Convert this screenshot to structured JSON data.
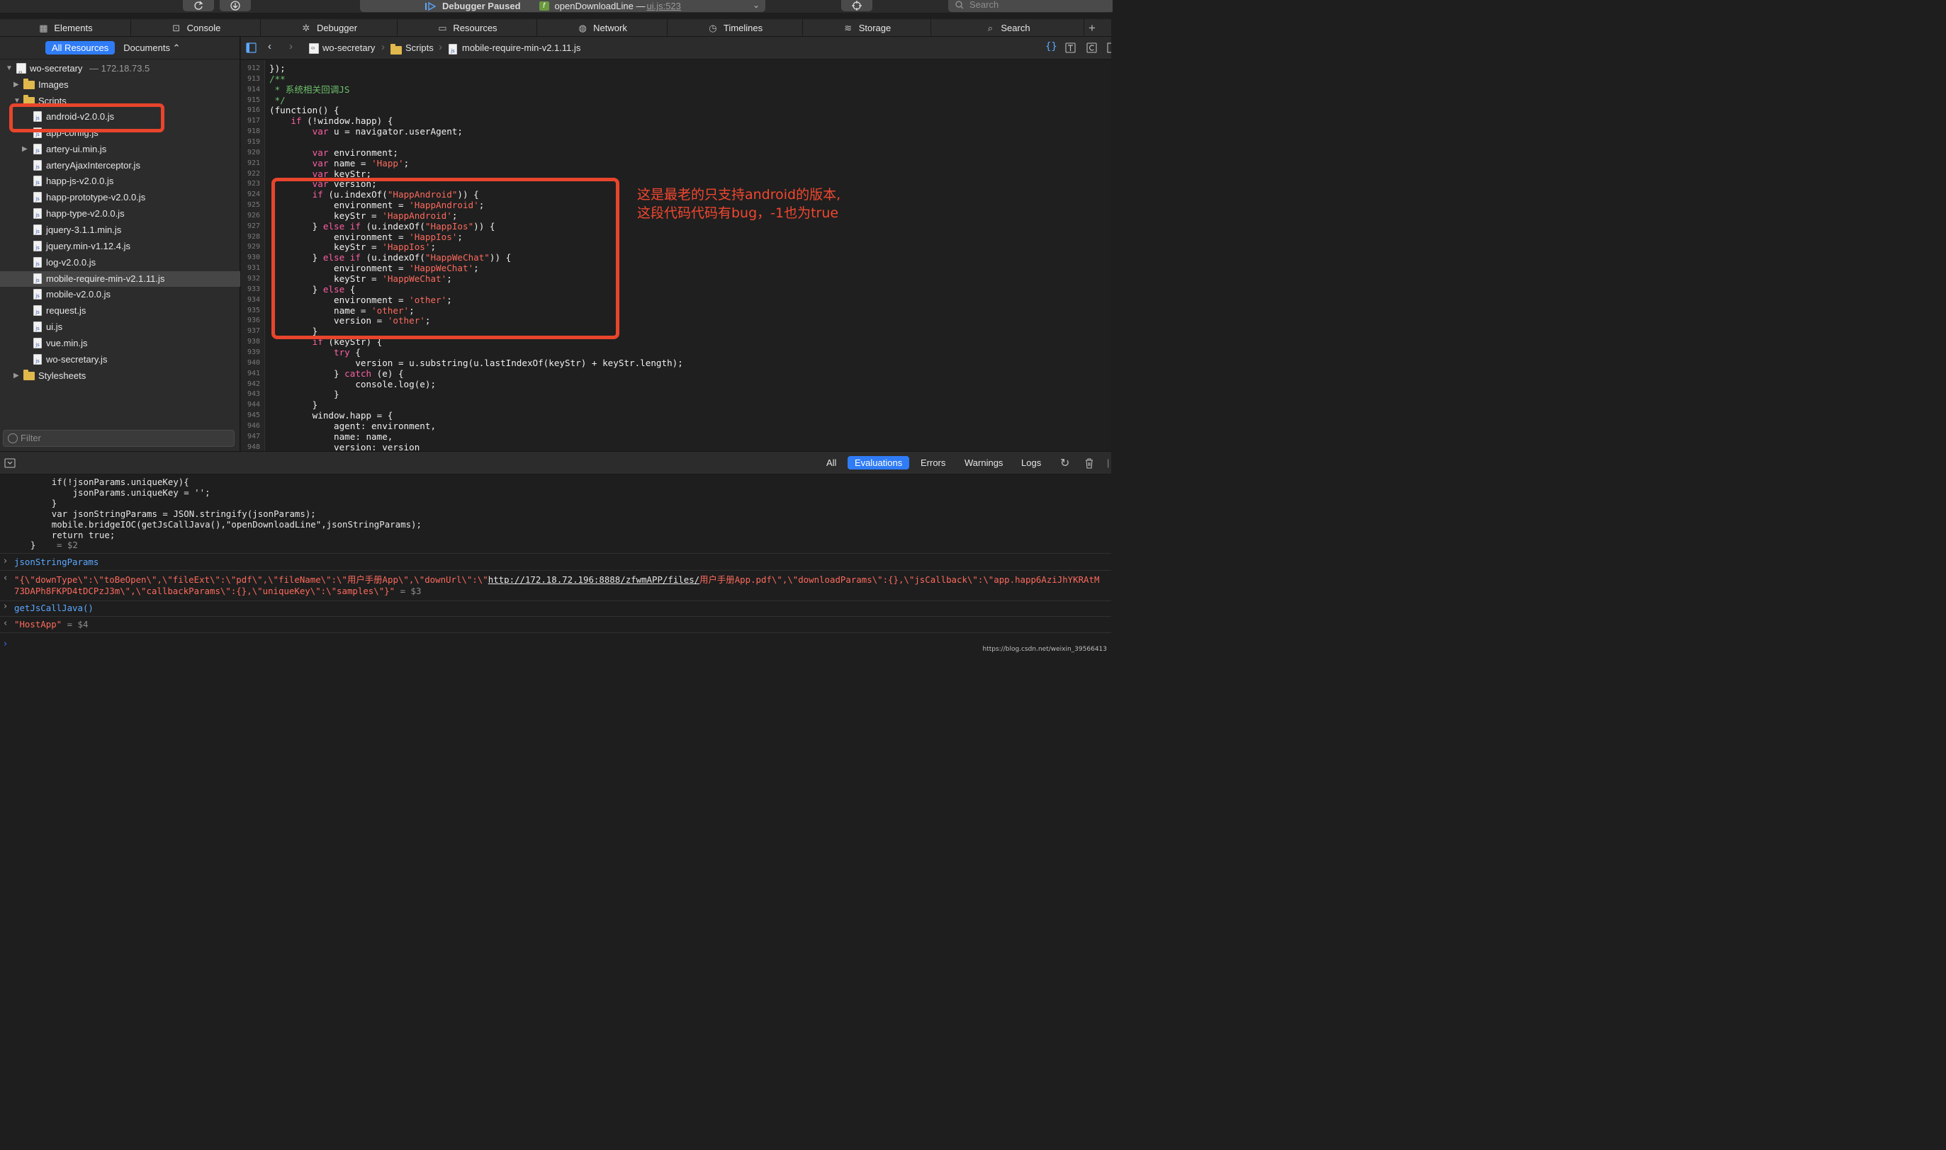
{
  "toolbar": {
    "debugger_status": "Debugger Paused",
    "function_name": "openDownloadLine —",
    "function_location": "ui.js:523",
    "search_placeholder": "Search"
  },
  "tabs": [
    {
      "label": "Elements",
      "icon": "elements-icon"
    },
    {
      "label": "Console",
      "icon": "console-icon"
    },
    {
      "label": "Debugger",
      "icon": "debugger-icon"
    },
    {
      "label": "Resources",
      "icon": "resources-icon"
    },
    {
      "label": "Network",
      "icon": "network-icon"
    },
    {
      "label": "Timelines",
      "icon": "timelines-icon"
    },
    {
      "label": "Storage",
      "icon": "storage-icon"
    },
    {
      "label": "Search",
      "icon": "search-icon"
    }
  ],
  "sidebar": {
    "all_resources": "All Resources",
    "documents": "Documents ⌃",
    "site_name": "wo-secretary",
    "site_address": "— 172.18.73.5",
    "folders": {
      "images": "Images",
      "scripts": "Scripts",
      "stylesheets": "Stylesheets"
    },
    "files": [
      "android-v2.0.0.js",
      "app-config.js",
      "artery-ui.min.js",
      "arteryAjaxInterceptor.js",
      "happ-js-v2.0.0.js",
      "happ-prototype-v2.0.0.js",
      "happ-type-v2.0.0.js",
      "jquery-3.1.1.min.js",
      "jquery.min-v1.12.4.js",
      "log-v2.0.0.js",
      "mobile-require-min-v2.1.11.js",
      "mobile-v2.0.0.js",
      "request.js",
      "ui.js",
      "vue.min.js",
      "wo-secretary.js"
    ],
    "selected_file": "mobile-require-min-v2.1.11.js",
    "filter_placeholder": "Filter"
  },
  "breadcrumb": {
    "site": "wo-secretary",
    "folder": "Scripts",
    "file": "mobile-require-min-v2.1.11.js"
  },
  "editor": {
    "line_numbers": [
      "912",
      "913",
      "914",
      "915",
      "916",
      "917",
      "918",
      "919",
      "920",
      "921",
      "922",
      "923",
      "924",
      "925",
      "926",
      "927",
      "928",
      "929",
      "930",
      "931",
      "932",
      "933",
      "934",
      "935",
      "936",
      "937",
      "938",
      "939",
      "940",
      "941",
      "942",
      "943",
      "944",
      "945",
      "946",
      "947",
      "948"
    ],
    "lines": [
      [
        [
          "p",
          "});"
        ]
      ],
      [
        [
          "c",
          "/**"
        ]
      ],
      [
        [
          "c",
          " * 系统相关回调JS"
        ]
      ],
      [
        [
          "c",
          " */"
        ]
      ],
      [
        [
          "p",
          "(function() {"
        ]
      ],
      [
        [
          "p",
          "    "
        ],
        [
          "k",
          "if"
        ],
        [
          "p",
          " (!window.happ) {"
        ]
      ],
      [
        [
          "p",
          "        "
        ],
        [
          "k",
          "var"
        ],
        [
          "p",
          " u = navigator.userAgent;"
        ]
      ],
      [
        [
          "p",
          ""
        ]
      ],
      [
        [
          "p",
          "        "
        ],
        [
          "k",
          "var"
        ],
        [
          "p",
          " environment;"
        ]
      ],
      [
        [
          "p",
          "        "
        ],
        [
          "k",
          "var"
        ],
        [
          "p",
          " name = "
        ],
        [
          "s",
          "'Happ'"
        ],
        [
          "p",
          ";"
        ]
      ],
      [
        [
          "p",
          "        "
        ],
        [
          "k",
          "var"
        ],
        [
          "p",
          " keyStr;"
        ]
      ],
      [
        [
          "p",
          "        "
        ],
        [
          "k",
          "var"
        ],
        [
          "p",
          " version;"
        ]
      ],
      [
        [
          "p",
          "        "
        ],
        [
          "k",
          "if"
        ],
        [
          "p",
          " (u.indexOf("
        ],
        [
          "s",
          "\"HappAndroid\""
        ],
        [
          "p",
          ")) {"
        ]
      ],
      [
        [
          "p",
          "            environment = "
        ],
        [
          "s",
          "'HappAndroid'"
        ],
        [
          "p",
          ";"
        ]
      ],
      [
        [
          "p",
          "            keyStr = "
        ],
        [
          "s",
          "'HappAndroid'"
        ],
        [
          "p",
          ";"
        ]
      ],
      [
        [
          "p",
          "        } "
        ],
        [
          "k",
          "else if"
        ],
        [
          "p",
          " (u.indexOf("
        ],
        [
          "s",
          "\"HappIos\""
        ],
        [
          "p",
          ")) {"
        ]
      ],
      [
        [
          "p",
          "            environment = "
        ],
        [
          "s",
          "'HappIos'"
        ],
        [
          "p",
          ";"
        ]
      ],
      [
        [
          "p",
          "            keyStr = "
        ],
        [
          "s",
          "'HappIos'"
        ],
        [
          "p",
          ";"
        ]
      ],
      [
        [
          "p",
          "        } "
        ],
        [
          "k",
          "else if"
        ],
        [
          "p",
          " (u.indexOf("
        ],
        [
          "s",
          "\"HappWeChat\""
        ],
        [
          "p",
          ")) {"
        ]
      ],
      [
        [
          "p",
          "            environment = "
        ],
        [
          "s",
          "'HappWeChat'"
        ],
        [
          "p",
          ";"
        ]
      ],
      [
        [
          "p",
          "            keyStr = "
        ],
        [
          "s",
          "'HappWeChat'"
        ],
        [
          "p",
          ";"
        ]
      ],
      [
        [
          "p",
          "        } "
        ],
        [
          "k",
          "else"
        ],
        [
          "p",
          " {"
        ]
      ],
      [
        [
          "p",
          "            environment = "
        ],
        [
          "s",
          "'other'"
        ],
        [
          "p",
          ";"
        ]
      ],
      [
        [
          "p",
          "            name = "
        ],
        [
          "s",
          "'other'"
        ],
        [
          "p",
          ";"
        ]
      ],
      [
        [
          "p",
          "            version = "
        ],
        [
          "s",
          "'other'"
        ],
        [
          "p",
          ";"
        ]
      ],
      [
        [
          "p",
          "        }"
        ]
      ],
      [
        [
          "p",
          "        "
        ],
        [
          "k",
          "if"
        ],
        [
          "p",
          " (keyStr) {"
        ]
      ],
      [
        [
          "p",
          "            "
        ],
        [
          "k",
          "try"
        ],
        [
          "p",
          " {"
        ]
      ],
      [
        [
          "p",
          "                version = u.substring(u.lastIndexOf(keyStr) + keyStr.length);"
        ]
      ],
      [
        [
          "p",
          "            } "
        ],
        [
          "k",
          "catch"
        ],
        [
          "p",
          " (e) {"
        ]
      ],
      [
        [
          "p",
          "                console.log(e);"
        ]
      ],
      [
        [
          "p",
          "            }"
        ]
      ],
      [
        [
          "p",
          "        }"
        ]
      ],
      [
        [
          "p",
          "        window.happ = {"
        ]
      ],
      [
        [
          "p",
          "            agent: environment,"
        ]
      ],
      [
        [
          "p",
          "            name: name,"
        ]
      ],
      [
        [
          "p",
          "            version: version"
        ]
      ]
    ]
  },
  "annotation": {
    "line1": "这是最老的只支持android的版本,",
    "line2": "这段代码代码有bug，-1也为true"
  },
  "console_bar": {
    "filters": [
      "All",
      "Evaluations",
      "Errors",
      "Warnings",
      "Logs"
    ],
    "selected": "Evaluations"
  },
  "console": {
    "func_lines": [
      "      if(!jsonParams.uniqueKey){",
      "          jsonParams.uniqueKey = '';",
      "      }",
      "      var jsonStringParams = JSON.stringify(jsonParams);",
      "      mobile.bridgeIOC(getJsCallJava(),\"openDownloadLine\",jsonStringParams);",
      "      return true;",
      "  }"
    ],
    "func_result": "= $2",
    "input1": "jsonStringParams",
    "output1_a": "\"{\\\"downType\\\":\\\"toBeOpen\\\",\\\"fileExt\\\":\\\"pdf\\\",\\\"fileName\\\":\\\"用户手册App\\\",\\\"downUrl\\\":\\\"",
    "output1_link": "http://172.18.72.196:8888/zfwmAPP/files/",
    "output1_b": "用户手册App.pdf\\\",\\\"downloadParams\\\":{},\\\"jsCallback\\\":\\\"app.happ6AziJhYKRAtM",
    "output1_c": "73DAPh8FKPD4tDCPzJ3m\\\",\\\"callbackParams\\\":{},\\\"uniqueKey\\\":\\\"samples\\\"}\"",
    "output1_result": "= $3",
    "input2": "getJsCallJava()",
    "output2": "\"HostApp\"",
    "output2_result": "= $4"
  },
  "watermark": "https://blog.csdn.net/weixin_39566413",
  "colors": {
    "accent": "#2f7cf6",
    "annotation": "#e8452c",
    "keyword": "#fc5fa3",
    "string": "#fc6a5d",
    "comment": "#6cbf6b"
  }
}
